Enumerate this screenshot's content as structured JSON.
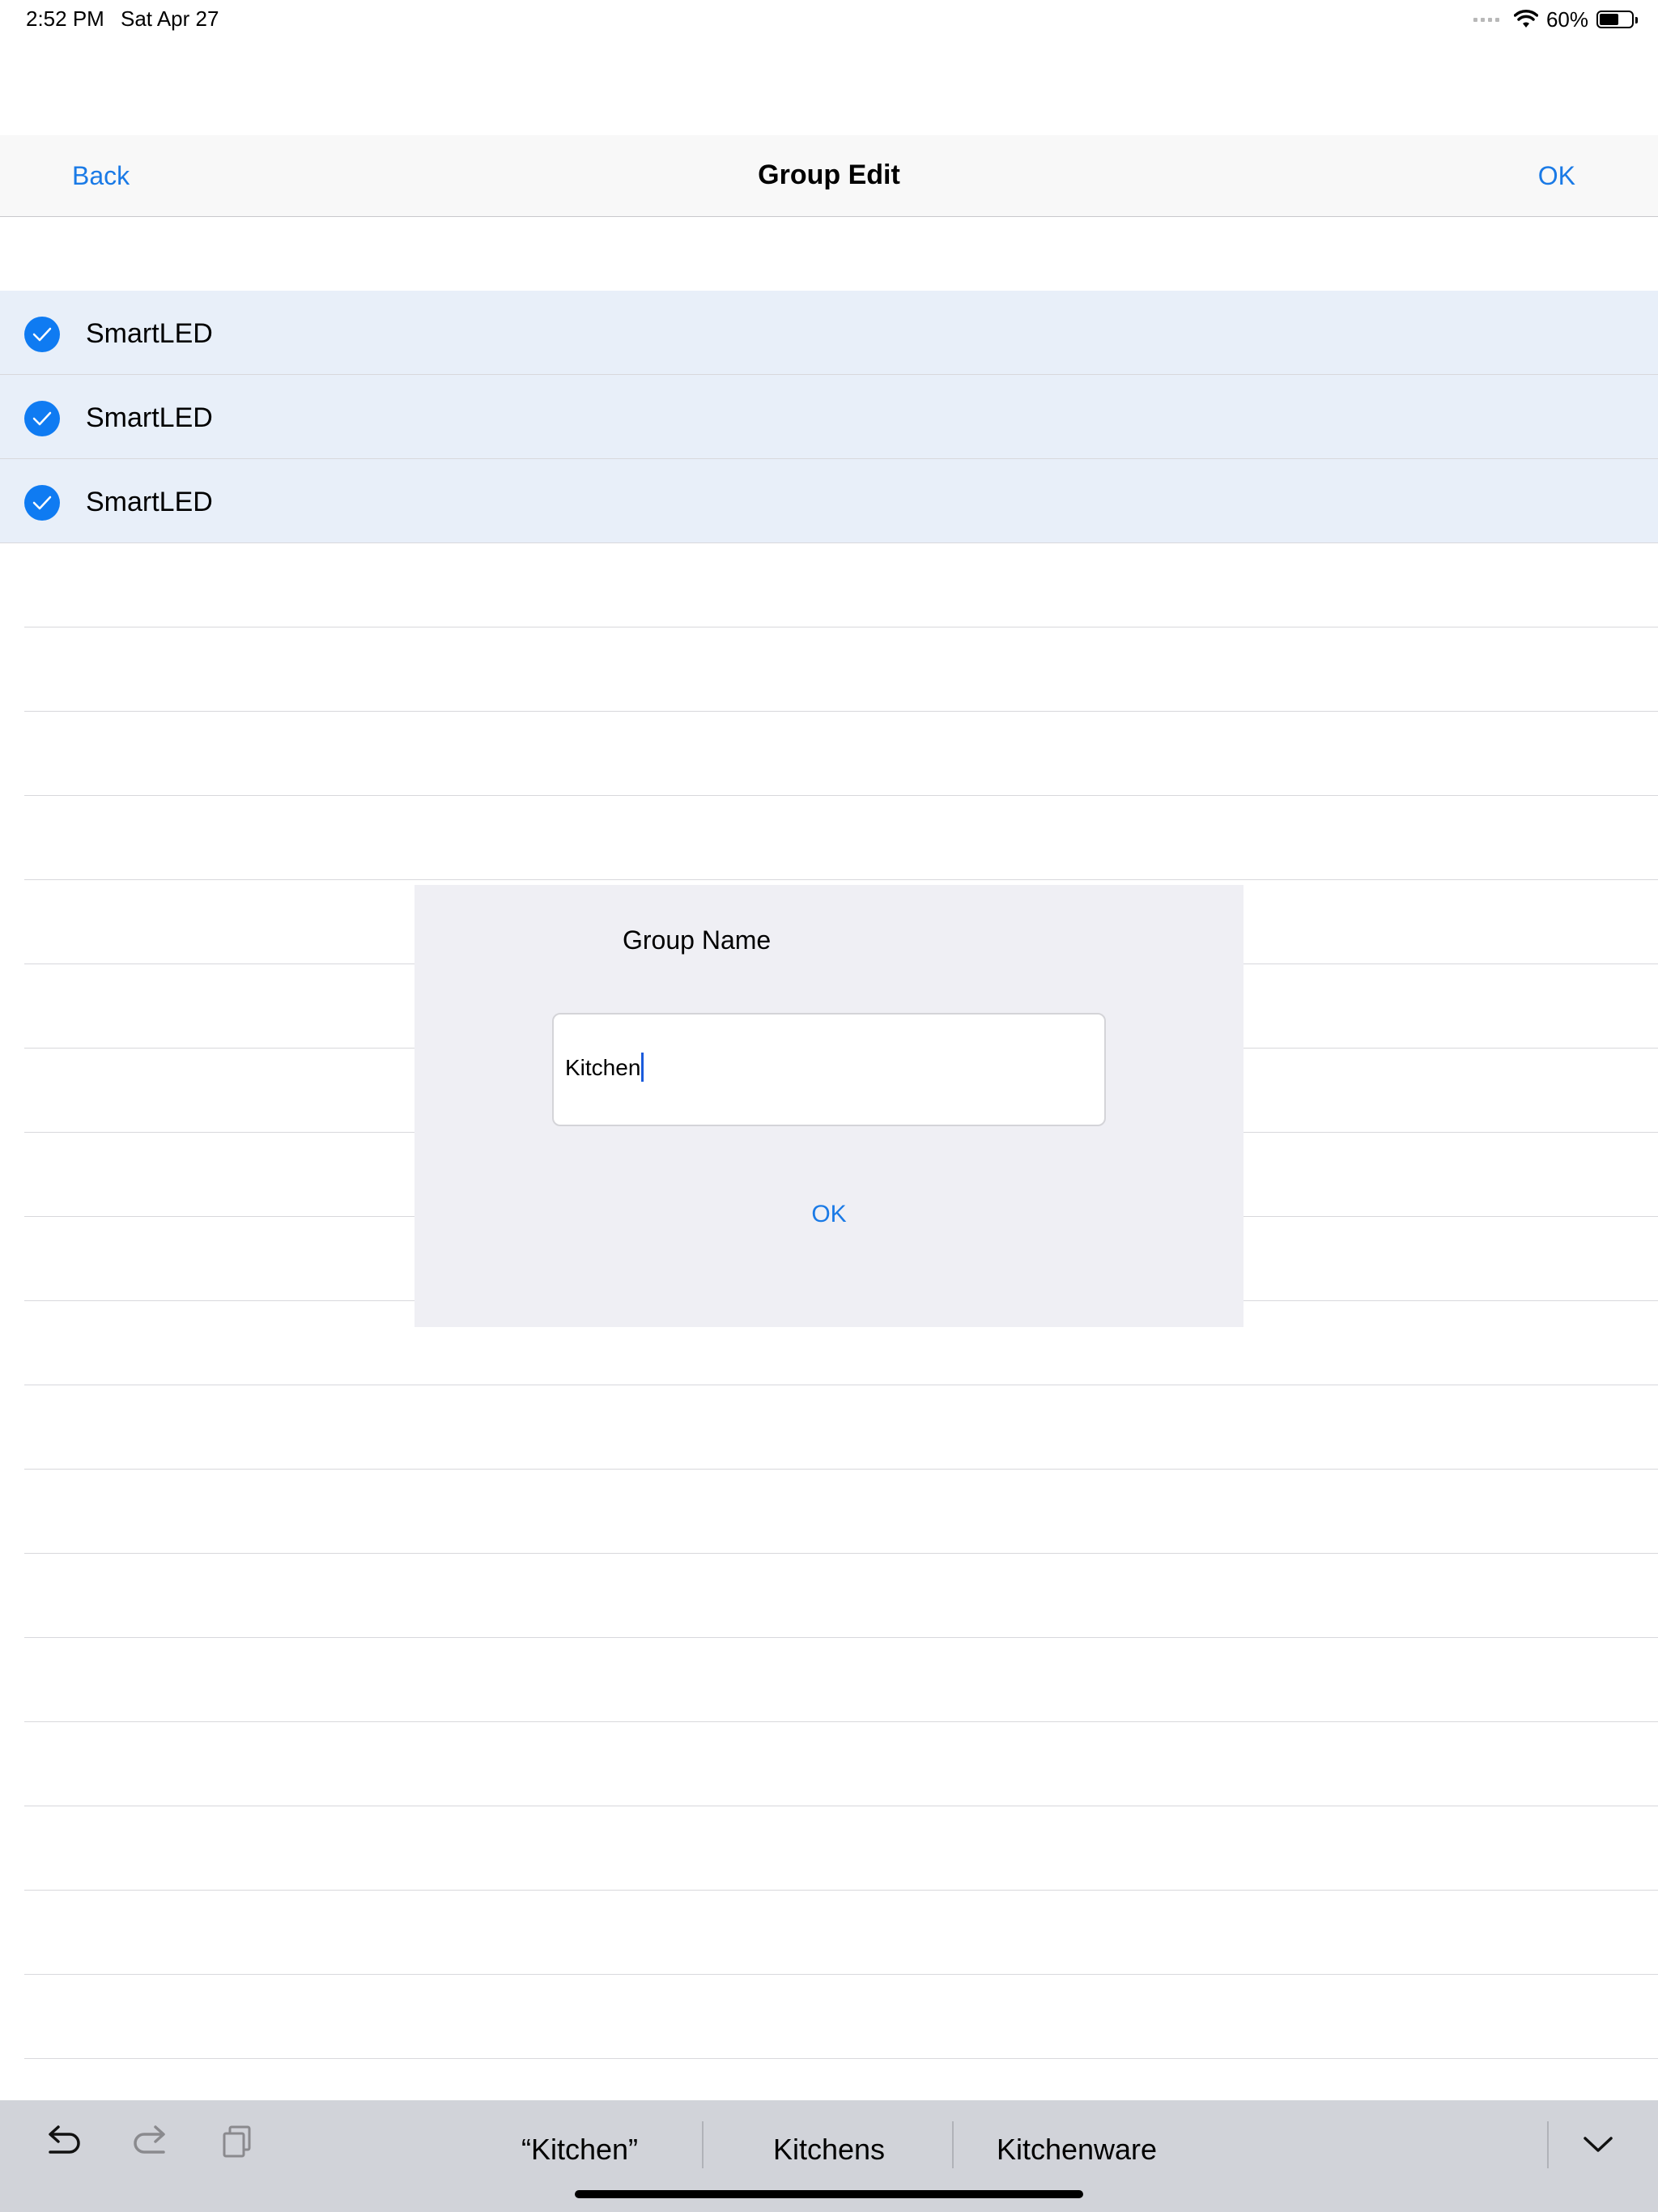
{
  "status_bar": {
    "time": "2:52 PM",
    "date": "Sat Apr 27",
    "battery": "60%",
    "battery_level": 0.6
  },
  "nav": {
    "back_label": "Back",
    "title": "Group Edit",
    "ok_label": "OK"
  },
  "devices": [
    {
      "name": "SmartLED",
      "selected": true
    },
    {
      "name": "SmartLED",
      "selected": true
    },
    {
      "name": "SmartLED",
      "selected": true
    }
  ],
  "empty_rows": 18,
  "dialog": {
    "title": "Group Name",
    "input_value": "Kitchen",
    "ok_label": "OK"
  },
  "keyboard_bar": {
    "suggestions": [
      "“Kitchen”",
      "Kitchens",
      "Kitchenware"
    ],
    "icons": [
      "undo-icon",
      "redo-icon",
      "paste-icon",
      "chevron-down-icon"
    ]
  },
  "colors": {
    "accent": "#1a7ae6",
    "selected_row": "#e8eff9",
    "dialog_bg": "#efeff4",
    "keyboard_bg": "#d1d3d9"
  }
}
